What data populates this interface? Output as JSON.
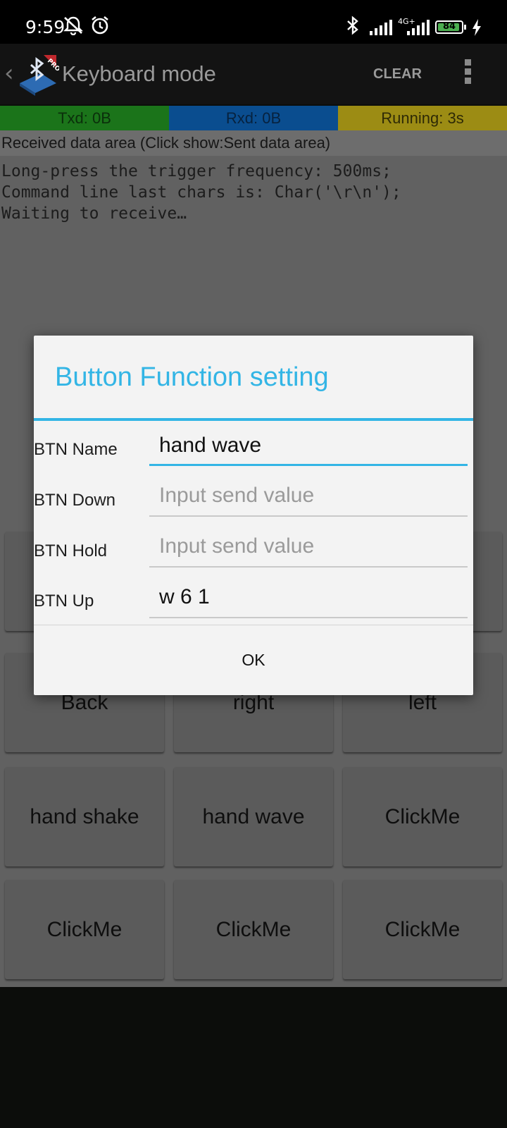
{
  "status_bar": {
    "time": "9:59",
    "network": "4G+",
    "battery_level": "84"
  },
  "app_bar": {
    "title": "Keyboard mode",
    "clear_label": "CLEAR",
    "logo_badge": "PRO"
  },
  "counters": [
    {
      "label": "Txd: 0B",
      "color": "#1b741a"
    },
    {
      "label": "Rxd: 0B",
      "color": "#0a4d8f"
    },
    {
      "label": "Running: 3s",
      "color": "#9c8c14"
    }
  ],
  "received": {
    "header": "Received data area   (Click show:Sent data area)",
    "lines": [
      "Long-press the trigger frequency: 500ms;",
      "Command line last chars is: Char('\\r\\n');",
      "Waiting to receive…"
    ]
  },
  "keyboard": {
    "buttons": [
      {
        "label": ""
      },
      {
        "label": ""
      },
      {
        "label": ""
      },
      {
        "label": "Back"
      },
      {
        "label": "right"
      },
      {
        "label": "left"
      },
      {
        "label": "hand shake"
      },
      {
        "label": "hand wave"
      },
      {
        "label": "ClickMe"
      },
      {
        "label": "ClickMe"
      },
      {
        "label": "ClickMe"
      },
      {
        "label": "ClickMe"
      }
    ]
  },
  "dialog": {
    "title": "Button Function setting",
    "fields": [
      {
        "label": "BTN Name",
        "value": "hand wave",
        "placeholder": ""
      },
      {
        "label": "BTN Down",
        "value": "",
        "placeholder": "Input send value"
      },
      {
        "label": "BTN Hold",
        "value": "",
        "placeholder": "Input send value"
      },
      {
        "label": "BTN Up",
        "value": "w 6 1",
        "placeholder": ""
      }
    ],
    "ok_label": "OK"
  },
  "colors": {
    "accent": "#33b5e5"
  }
}
